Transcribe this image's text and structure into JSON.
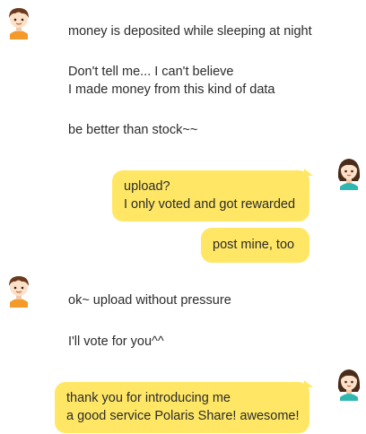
{
  "chat": {
    "group1": {
      "avatar": "boy-avatar-icon",
      "messages": [
        "money is deposited while sleeping at night",
        "Don't tell me...  I can't believe",
        "I made money from this kind of data",
        "be better than stock~~"
      ]
    },
    "group2": {
      "avatar": "girl-avatar-icon",
      "bubble1": [
        "upload?",
        "I only voted and got rewarded"
      ],
      "bubble2": "post mine, too"
    },
    "group3": {
      "avatar": "boy-avatar-icon",
      "messages": [
        "ok~ upload without pressure",
        "I'll vote for you^^"
      ]
    },
    "group4": {
      "avatar": "girl-avatar-icon",
      "bubble1": [
        "thank you for introducing me",
        "a good service Polaris Share! awesome!"
      ]
    }
  },
  "colors": {
    "bubble": "#ffe765",
    "text": "#2b2b2b",
    "boy_hair": "#6b3a1e",
    "boy_shirt": "#f39a2b",
    "girl_hair": "#4a2a1a",
    "girl_shirt": "#2fb7b0",
    "skin": "#fde0c8"
  }
}
